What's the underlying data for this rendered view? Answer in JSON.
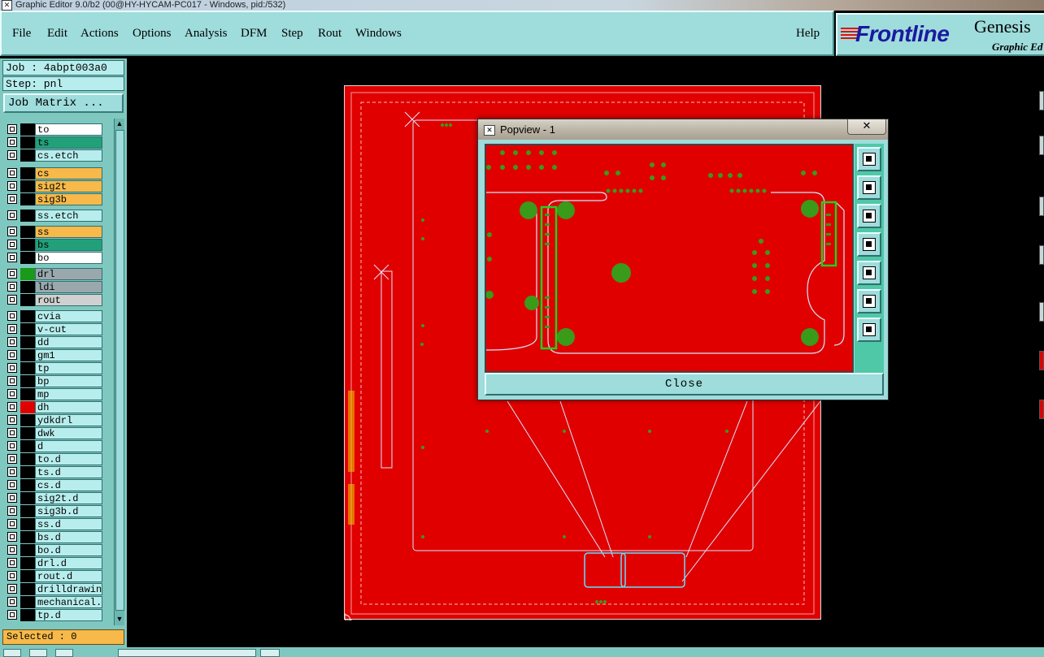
{
  "window": {
    "title": "Graphic Editor 9.0/b2 (00@HY-HYCAM-PC017 - Windows, pid:/532)"
  },
  "menu": {
    "items": [
      "File",
      "Edit",
      "Actions",
      "Options",
      "Analysis",
      "DFM",
      "Step",
      "Rout",
      "Windows"
    ],
    "help": "Help"
  },
  "logo": {
    "brand": "Frontline",
    "product": "Genesis",
    "subtitle": "Graphic Ed"
  },
  "panel": {
    "job": "Job : 4abpt003a0",
    "step": "Step: pnl",
    "job_matrix": "Job Matrix ...",
    "selected": "Selected : 0"
  },
  "layers": [
    {
      "name": "to",
      "bg": "#ffffff",
      "color": "#000000"
    },
    {
      "name": "ts",
      "bg": "#22a07a",
      "color": "#000000"
    },
    {
      "name": "cs.etch",
      "bg": "#b8eded",
      "color": "#000000"
    },
    {
      "name": "cs",
      "bg": "#f6b94a",
      "color": "#000000"
    },
    {
      "name": "sig2t",
      "bg": "#f6b94a",
      "color": "#000000"
    },
    {
      "name": "sig3b",
      "bg": "#f6b94a",
      "color": "#000000"
    },
    {
      "name": "ss.etch",
      "bg": "#b8eded",
      "color": "#000000"
    },
    {
      "name": "ss",
      "bg": "#f6b94a",
      "color": "#000000"
    },
    {
      "name": "bs",
      "bg": "#22a07a",
      "color": "#000000"
    },
    {
      "name": "bo",
      "bg": "#ffffff",
      "color": "#000000"
    },
    {
      "name": "drl",
      "bg": "#9aa8ae",
      "color": "#1a9a1a"
    },
    {
      "name": "ldi",
      "bg": "#9aa8ae",
      "color": "#000000"
    },
    {
      "name": "rout",
      "bg": "#d0d0d0",
      "color": "#000000"
    },
    {
      "name": "cvia",
      "bg": "#b8eded",
      "color": "#000000"
    },
    {
      "name": "v-cut",
      "bg": "#b8eded",
      "color": "#000000"
    },
    {
      "name": "dd",
      "bg": "#b8eded",
      "color": "#000000"
    },
    {
      "name": "gm1",
      "bg": "#b8eded",
      "color": "#000000"
    },
    {
      "name": "tp",
      "bg": "#b8eded",
      "color": "#000000"
    },
    {
      "name": "bp",
      "bg": "#b8eded",
      "color": "#000000"
    },
    {
      "name": "mp",
      "bg": "#b8eded",
      "color": "#000000"
    },
    {
      "name": "dh",
      "bg": "#b8eded",
      "color": "#e00000"
    },
    {
      "name": "ydkdrl",
      "bg": "#b8eded",
      "color": "#000000"
    },
    {
      "name": "dwk",
      "bg": "#b8eded",
      "color": "#000000"
    },
    {
      "name": "d",
      "bg": "#b8eded",
      "color": "#000000"
    },
    {
      "name": "to.d",
      "bg": "#b8eded",
      "color": "#000000"
    },
    {
      "name": "ts.d",
      "bg": "#b8eded",
      "color": "#000000"
    },
    {
      "name": "cs.d",
      "bg": "#b8eded",
      "color": "#000000"
    },
    {
      "name": "sig2t.d",
      "bg": "#b8eded",
      "color": "#000000"
    },
    {
      "name": "sig3b.d",
      "bg": "#b8eded",
      "color": "#000000"
    },
    {
      "name": "ss.d",
      "bg": "#b8eded",
      "color": "#000000"
    },
    {
      "name": "bs.d",
      "bg": "#b8eded",
      "color": "#000000"
    },
    {
      "name": "bo.d",
      "bg": "#b8eded",
      "color": "#000000"
    },
    {
      "name": "drl.d",
      "bg": "#b8eded",
      "color": "#000000"
    },
    {
      "name": "rout.d",
      "bg": "#b8eded",
      "color": "#000000"
    },
    {
      "name": "drilldrawing",
      "bg": "#b8eded",
      "color": "#000000"
    },
    {
      "name": "mechanical.p",
      "bg": "#b8eded",
      "color": "#000000"
    },
    {
      "name": "tp.d",
      "bg": "#b8eded",
      "color": "#000000"
    }
  ],
  "popview": {
    "title": "Popview - 1",
    "close_x": "✕",
    "close_label": "Close",
    "tools": [
      "zoom-window-icon",
      "zoom-in-icon",
      "zoom-out-icon",
      "pan-left-icon",
      "pan-right-icon",
      "fit-all-icon",
      "fit-center-icon"
    ]
  },
  "colors": {
    "board_fill": "#e00000",
    "pad_green": "#3a9a1a",
    "panel_bg": "#9fdcdc",
    "highlight_green": "#20d020"
  }
}
